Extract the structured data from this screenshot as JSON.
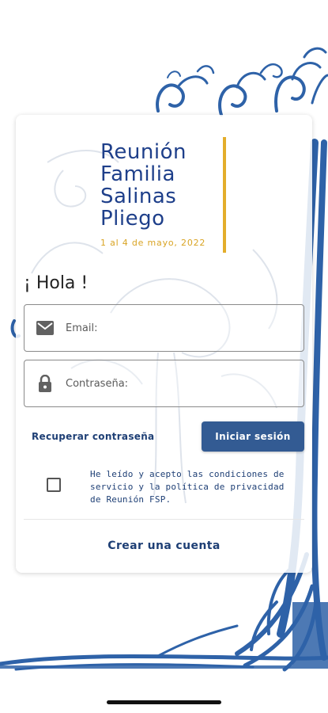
{
  "header": {
    "title": "Reunión\nFamilia\nSalinas\nPliego",
    "subtitle": "1 al 4 de mayo, 2022"
  },
  "greeting": "¡ Hola !",
  "form": {
    "email_placeholder": "Email:",
    "password_placeholder": "Contraseña:",
    "recover_label": "Recuperar contraseña",
    "login_label": "Iniciar sesión",
    "terms_text": "He leído y acepto las condiciones de servicio y la política de privacidad de Reunión FSP.",
    "terms_checked": false,
    "create_account_label": "Crear una cuenta"
  },
  "colors": {
    "brand_blue": "#1e3f8a",
    "button_blue": "#335b93",
    "gold": "#e3ad2b",
    "tree_blue": "#2e62a8"
  },
  "icons": [
    "email-icon",
    "lock-icon",
    "tree-background"
  ]
}
